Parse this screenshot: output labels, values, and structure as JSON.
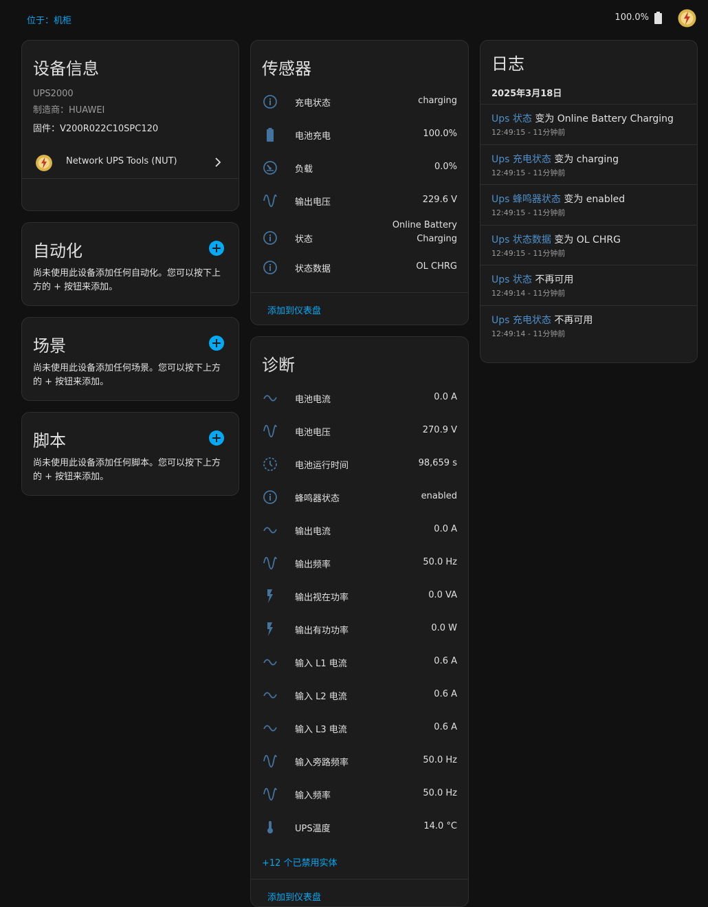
{
  "topbar": {
    "area": "位于：机柜",
    "battery": "100.0%"
  },
  "device_info": {
    "title": "设备信息",
    "model": "UPS2000",
    "manufacturer": "制造商：HUAWEI",
    "firmware": "固件：V200R022C10SPC120",
    "integration": "Network UPS Tools (NUT)"
  },
  "automation": {
    "title": "自动化",
    "empty": "尚未使用此设备添加任何自动化。您可以按下上方的 + 按钮来添加。"
  },
  "scenes": {
    "title": "场景",
    "empty": "尚未使用此设备添加任何场景。您可以按下上方的 + 按钮来添加。"
  },
  "scripts": {
    "title": "脚本",
    "empty": "尚未使用此设备添加任何脚本。您可以按下上方的 + 按钮来添加。"
  },
  "sensors": {
    "title": "传感器",
    "add_to_dashboard": "添加到仪表盘",
    "rows": [
      {
        "icon": "info-icon",
        "name": "充电状态",
        "value": "charging"
      },
      {
        "icon": "battery-icon",
        "name": "电池充电",
        "value": "100.0%"
      },
      {
        "icon": "gauge-icon",
        "name": "负载",
        "value": "0.0%"
      },
      {
        "icon": "sine-wave-icon",
        "name": "输出电压",
        "value": "229.6 V"
      },
      {
        "icon": "info-icon",
        "name": "状态",
        "value": "Online Battery Charging"
      },
      {
        "icon": "info-icon",
        "name": "状态数据",
        "value": "OL CHRG"
      }
    ]
  },
  "diagnostics": {
    "title": "诊断",
    "disabled_entities": "+12 个已禁用实体",
    "add_to_dashboard": "添加到仪表盘",
    "rows": [
      {
        "icon": "current-ac-icon",
        "name": "电池电流",
        "value": "0.0 A"
      },
      {
        "icon": "sine-wave-icon",
        "name": "电池电压",
        "value": "270.9 V"
      },
      {
        "icon": "timer-icon",
        "name": "电池运行时间",
        "value": "98,659 s"
      },
      {
        "icon": "info-icon",
        "name": "蜂鸣器状态",
        "value": "enabled"
      },
      {
        "icon": "current-ac-icon",
        "name": "输出电流",
        "value": "0.0 A"
      },
      {
        "icon": "sine-wave-icon",
        "name": "输出频率",
        "value": "50.0 Hz"
      },
      {
        "icon": "flash-icon",
        "name": "输出视在功率",
        "value": "0.0 VA"
      },
      {
        "icon": "flash-icon",
        "name": "输出有功功率",
        "value": "0.0 W"
      },
      {
        "icon": "current-ac-icon",
        "name": "输入 L1 电流",
        "value": "0.6 A"
      },
      {
        "icon": "current-ac-icon",
        "name": "输入 L2 电流",
        "value": "0.6 A"
      },
      {
        "icon": "current-ac-icon",
        "name": "输入 L3 电流",
        "value": "0.6 A"
      },
      {
        "icon": "sine-wave-icon",
        "name": "输入旁路频率",
        "value": "50.0 Hz"
      },
      {
        "icon": "sine-wave-icon",
        "name": "输入频率",
        "value": "50.0 Hz"
      },
      {
        "icon": "thermometer-icon",
        "name": "UPS温度",
        "value": "14.0 °C"
      }
    ]
  },
  "logbook": {
    "title": "日志",
    "date": "2025年3月18日",
    "entries": [
      {
        "entity": "Ups 状态",
        "message": " 变为 Online Battery Charging",
        "time": "12:49:15 - 11分钟前"
      },
      {
        "entity": "Ups 充电状态",
        "message": " 变为 charging",
        "time": "12:49:15 - 11分钟前"
      },
      {
        "entity": "Ups 蜂鸣器状态",
        "message": " 变为 enabled",
        "time": "12:49:15 - 11分钟前"
      },
      {
        "entity": "Ups 状态数据",
        "message": " 变为 OL CHRG",
        "time": "12:49:15 - 11分钟前"
      },
      {
        "entity": "Ups 状态",
        "message": " 不再可用",
        "time": "12:49:14 - 11分钟前"
      },
      {
        "entity": "Ups 充电状态",
        "message": " 不再可用",
        "time": "12:49:14 - 11分钟前"
      }
    ]
  },
  "colors": {
    "accent": "#03a9f4",
    "icon": "#44739e",
    "card": "#1c1c1c",
    "background": "#111111"
  }
}
